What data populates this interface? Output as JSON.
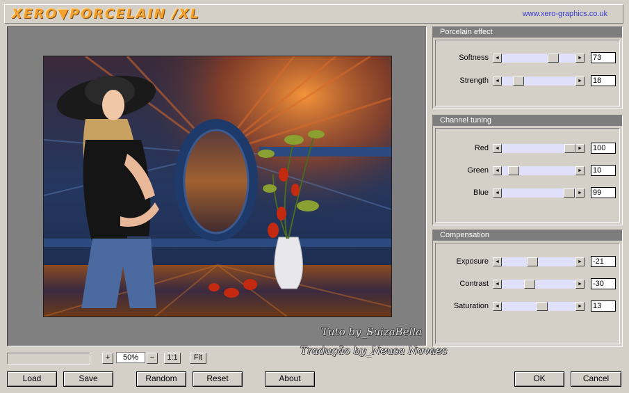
{
  "header": {
    "logo_text": "XERO▼PORCELAIN /XL",
    "website": "www.xero-graphics.co.uk"
  },
  "groups": [
    {
      "title": "Porcelain effect",
      "sliders": [
        {
          "label": "Softness",
          "value": "73",
          "fraction": 0.73
        },
        {
          "label": "Strength",
          "value": "18",
          "fraction": 0.18
        }
      ]
    },
    {
      "title": "Channel tuning",
      "sliders": [
        {
          "label": "Red",
          "value": "100",
          "fraction": 1.0
        },
        {
          "label": "Green",
          "value": "10",
          "fraction": 0.1
        },
        {
          "label": "Blue",
          "value": "99",
          "fraction": 0.99
        }
      ]
    },
    {
      "title": "Compensation",
      "sliders": [
        {
          "label": "Exposure",
          "value": "-21",
          "fraction": 0.4
        },
        {
          "label": "Contrast",
          "value": "-30",
          "fraction": 0.36
        },
        {
          "label": "Saturation",
          "value": "13",
          "fraction": 0.56
        }
      ]
    }
  ],
  "zoom": {
    "plus": "+",
    "value": "50%",
    "minus": "−",
    "one_to_one": "1:1",
    "fit": "Fit"
  },
  "buttons": {
    "load": "Load",
    "save": "Save",
    "random": "Random",
    "reset": "Reset",
    "about": "About",
    "ok": "OK",
    "cancel": "Cancel"
  },
  "watermark": {
    "line1": "Tuto by_SuizaBella",
    "line2": "Tradução by_Neusa Novaes"
  },
  "colors": {
    "window_bg": "#d4d0c8",
    "group_header": "#7d7d7d",
    "slider_track": "#e0e0fa",
    "preview_bg": "#808080",
    "website_link": "#3a3acc"
  }
}
